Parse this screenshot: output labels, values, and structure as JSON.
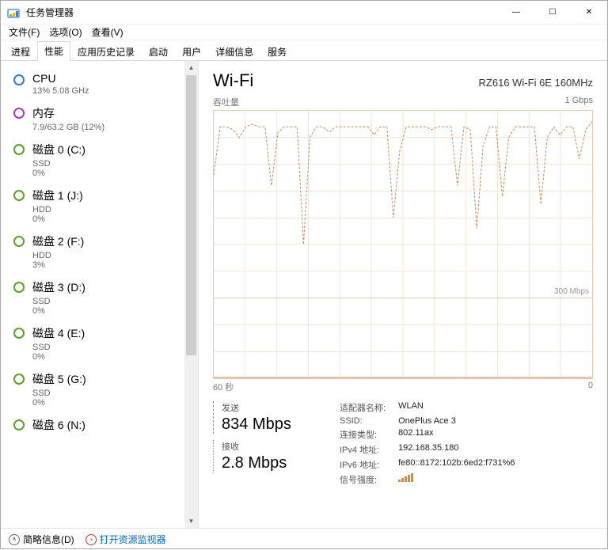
{
  "window": {
    "title": "任务管理器",
    "min": "—",
    "max": "☐",
    "close": "✕"
  },
  "menu": {
    "file": "文件(F)",
    "options": "选项(O)",
    "view": "查看(V)"
  },
  "tabs": {
    "processes": "进程",
    "performance": "性能",
    "app_history": "应用历史记录",
    "startup": "启动",
    "users": "用户",
    "details": "详细信息",
    "services": "服务"
  },
  "sidebar": [
    {
      "kind": "cpu",
      "name": "CPU",
      "sub": "13% 5.08 GHz"
    },
    {
      "kind": "mem",
      "name": "内存",
      "sub": "7.9/63.2 GB (12%)"
    },
    {
      "kind": "disk",
      "name": "磁盘 0 (C:)",
      "sub": "SSD\n0%"
    },
    {
      "kind": "disk",
      "name": "磁盘 1 (J:)",
      "sub": "HDD\n0%"
    },
    {
      "kind": "disk",
      "name": "磁盘 2 (F:)",
      "sub": "HDD\n3%"
    },
    {
      "kind": "disk",
      "name": "磁盘 3 (D:)",
      "sub": "SSD\n0%"
    },
    {
      "kind": "disk",
      "name": "磁盘 4 (E:)",
      "sub": "SSD\n0%"
    },
    {
      "kind": "disk",
      "name": "磁盘 5 (G:)",
      "sub": "SSD\n0%"
    },
    {
      "kind": "disk",
      "name": "磁盘 6 (N:)",
      "sub": ""
    }
  ],
  "detail": {
    "title": "Wi-Fi",
    "adapter": "RZ616 Wi-Fi 6E 160MHz",
    "chart_y_label": "吞吐量",
    "chart_y_max": "1 Gbps",
    "chart_mid_label": "300 Mbps",
    "chart_x_left": "60 秒",
    "chart_x_right": "0",
    "send_caption": "发送",
    "send_value": "834 Mbps",
    "recv_caption": "接收",
    "recv_value": "2.8 Mbps",
    "info": {
      "adapter_name_label": "适配器名称:",
      "adapter_name": "WLAN",
      "ssid_label": "SSID:",
      "ssid": "OnePlus Ace 3",
      "conn_type_label": "连接类型:",
      "conn_type": "802.11ax",
      "ipv4_label": "IPv4 地址:",
      "ipv4": "192.168.35.180",
      "ipv6_label": "IPv6 地址:",
      "ipv6": "fe80::8172:102b:6ed2:f731%6",
      "signal_label": "信号强度:"
    }
  },
  "footer": {
    "less": "简略信息(D)",
    "resmon": "打开资源监视器"
  },
  "chart_data": {
    "type": "line",
    "title": "吞吐量",
    "xlabel": "60 秒 → 0",
    "ylabel": "吞吐量",
    "ylim": [
      0,
      1000
    ],
    "yunit": "Mbps",
    "x": [
      0,
      1,
      2,
      3,
      4,
      5,
      6,
      7,
      8,
      9,
      10,
      11,
      12,
      13,
      14,
      15,
      16,
      17,
      18,
      19,
      20,
      21,
      22,
      23,
      24,
      25,
      26,
      27,
      28,
      29,
      30,
      31,
      32,
      33,
      34,
      35,
      36,
      37,
      38,
      39,
      40,
      41,
      42,
      43,
      44,
      45,
      46,
      47,
      48,
      49,
      50,
      51,
      52,
      53,
      54,
      55,
      56,
      57,
      58,
      59
    ],
    "series": [
      {
        "name": "发送",
        "color": "#c88854",
        "values": [
          760,
          940,
          940,
          930,
          900,
          940,
          950,
          940,
          940,
          720,
          920,
          940,
          940,
          940,
          500,
          900,
          940,
          940,
          920,
          940,
          940,
          940,
          940,
          940,
          940,
          910,
          940,
          940,
          600,
          850,
          940,
          940,
          940,
          940,
          930,
          940,
          940,
          940,
          720,
          940,
          930,
          560,
          870,
          940,
          940,
          680,
          900,
          940,
          940,
          940,
          940,
          650,
          900,
          940,
          910,
          940,
          940,
          820,
          930,
          960
        ]
      },
      {
        "name": "接收",
        "color": "#c88854",
        "values": [
          3,
          3,
          3,
          3,
          3,
          3,
          3,
          3,
          3,
          3,
          3,
          3,
          3,
          3,
          3,
          3,
          3,
          3,
          3,
          3,
          3,
          3,
          3,
          3,
          3,
          3,
          3,
          3,
          3,
          3,
          3,
          3,
          3,
          3,
          3,
          3,
          3,
          3,
          3,
          3,
          3,
          3,
          3,
          3,
          3,
          3,
          3,
          3,
          3,
          3,
          3,
          3,
          3,
          3,
          3,
          3,
          3,
          3,
          3,
          3
        ]
      }
    ],
    "gridline_at": 300
  }
}
